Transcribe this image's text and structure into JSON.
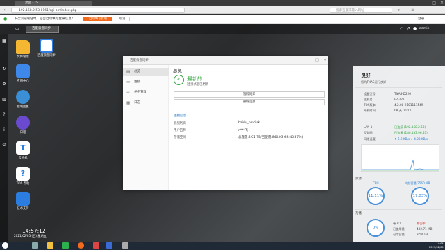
{
  "browser": {
    "tab_title": "桌面 - TS",
    "url": "192.168.2.53:8161/cgi-bin/index.php",
    "search_placeholder": "搜索百度或输入网址",
    "win_controls": [
      "—",
      "□",
      "✕"
    ]
  },
  "notice": {
    "text": "下次浏览网站时，是否自动填写登录信息？",
    "primary_button": "自动填写此项",
    "cancel_button": "取消",
    "right_label": "登录"
  },
  "qts": {
    "active_app_tab": "百度云盘同步",
    "user": "admin"
  },
  "desktop_icons": [
    {
      "label": "文件管理",
      "color": "#f5b731"
    },
    {
      "label": "百度云盘同步",
      "color": "#2f7de1"
    },
    {
      "label": "应用中心",
      "color": "#3d88e8"
    },
    {
      "label": "控制面板",
      "color": "#3a8fd6"
    },
    {
      "label": "日程",
      "color": "#6a4bd0"
    },
    {
      "label": "云相机",
      "color": "#ffffff"
    },
    {
      "label": "TOS 帮助",
      "color": "#ffffff"
    },
    {
      "label": "技术支持",
      "color": "#2b7ee0"
    }
  ],
  "clock": {
    "time": "14:57:12",
    "date": "2021/02/05 (日) 星期五"
  },
  "window": {
    "title": "百度云盘同步",
    "nav": [
      {
        "label": "总览",
        "icon": "overview-icon",
        "active": true
      },
      {
        "label": "连接",
        "icon": "link-icon",
        "active": false
      },
      {
        "label": "任务管理",
        "icon": "task-icon",
        "active": false
      },
      {
        "label": "日志",
        "icon": "log-icon",
        "active": false
      }
    ],
    "page_title": "总览",
    "status_main": "最新的",
    "status_sub": "连接状态已更新",
    "buttons": [
      "暂停同步",
      "删除连接"
    ],
    "conn_heading": "连接信息",
    "fields": [
      {
        "key": "云服务商",
        "value": "baidu_netdisk"
      },
      {
        "key": "用户名称",
        "value": "n***飞"
      },
      {
        "key": "存储空间",
        "value": "总容量:2.01 TB/已使用:840.03 GB(40.87%)"
      }
    ]
  },
  "monitor": {
    "status": "良好",
    "status_sub": "您的TNAS运行良好",
    "info": [
      {
        "key": "设备型号",
        "value": "TNAS-D226"
      },
      {
        "key": "主机名",
        "value": "F2-221"
      },
      {
        "key": "TOS版本",
        "value": "4.2.08-2101111549"
      },
      {
        "key": "开机时间",
        "value": "08 天 00:12"
      }
    ],
    "net": [
      {
        "key": "LAN 1",
        "value": "已连接 (192.168.2.53)"
      },
      {
        "key": "互联网",
        "value": "已连接 (180.133.96.53)"
      },
      {
        "key": "网络速度",
        "value": "↑ 6.9 KB/s   ↓ 4.08 KB/s"
      }
    ],
    "sections": {
      "cpu_label": "资源",
      "storage_label": "存储"
    },
    "cpu": {
      "label": "CPU",
      "value": "11.11%",
      "fraction": 0.1111
    },
    "mem": {
      "label": "内存容量 2560 MB",
      "value": "17.03%",
      "fraction": 0.1703
    },
    "storage": {
      "value": "0%",
      "disk_label": "卷 #1",
      "state": "警告中",
      "used_key": "已使用量",
      "used_value": "402.71 MB",
      "total_key": "可用容量",
      "total_value": "3.54 TB"
    }
  },
  "taskbar": {
    "time": "14:04",
    "date": "2021/02/05"
  }
}
